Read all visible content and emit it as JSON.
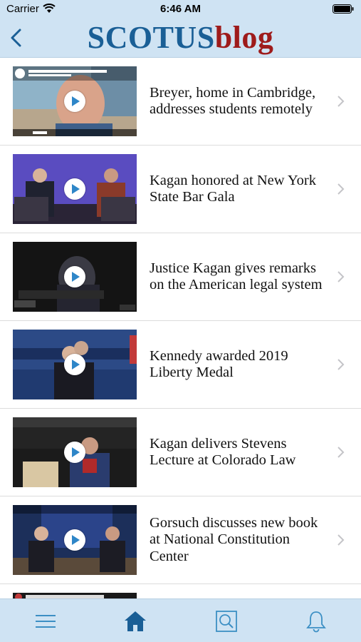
{
  "status_bar": {
    "carrier": "Carrier",
    "time": "6:46 AM"
  },
  "header": {
    "logo_scotus": "SCOTUS",
    "logo_blog": "blog"
  },
  "colors": {
    "bar_background": "#cfe3f3",
    "logo_blue": "#1a5f96",
    "logo_red": "#9e1b1b",
    "tab_active": "#1a5f96",
    "tab_inactive": "#3c8fc4"
  },
  "videos": [
    {
      "title": "Breyer, home in Cambridge, addresses students remotely"
    },
    {
      "title": "Kagan honored at New York State Bar Gala"
    },
    {
      "title": "Justice Kagan gives remarks on the American legal system"
    },
    {
      "title": "Kennedy awarded 2019 Liberty Medal"
    },
    {
      "title": "Kagan delivers Stevens Lecture at Colorado Law"
    },
    {
      "title": "Gorsuch discusses new book at National Constitution Center"
    },
    {
      "title": ""
    }
  ],
  "tabs": [
    {
      "name": "menu-icon",
      "active": false
    },
    {
      "name": "home-icon",
      "active": true
    },
    {
      "name": "search-icon",
      "active": false
    },
    {
      "name": "bell-icon",
      "active": false
    }
  ]
}
